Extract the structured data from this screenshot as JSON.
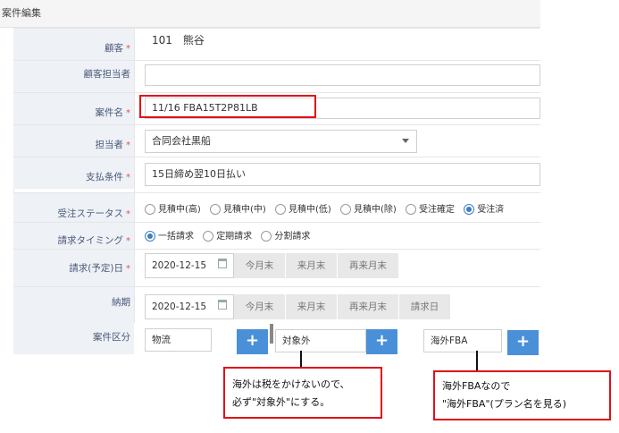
{
  "header": {
    "title": "案件編集"
  },
  "form": {
    "customer": {
      "label": "顧客",
      "value": "101　熊谷"
    },
    "customer_contact": {
      "label": "顧客担当者",
      "value": ""
    },
    "project_name": {
      "label": "案件名",
      "value": "11/16  FBA15T2P81LB"
    },
    "assignee": {
      "label": "担当者",
      "value": "合同会社黒船"
    },
    "payment_terms": {
      "label": "支払条件",
      "value": "15日締め翌10日払い"
    },
    "order_status": {
      "label": "受注ステータス",
      "options": [
        "見積中(高)",
        "見積中(中)",
        "見積中(低)",
        "見積中(除)",
        "受注確定",
        "受注済"
      ],
      "selected": "受注済"
    },
    "billing_timing": {
      "label": "請求タイミング",
      "options": [
        "一括請求",
        "定期請求",
        "分割請求"
      ],
      "selected": "一括請求"
    },
    "billing_date": {
      "label": "請求(予定)日",
      "value": "2020-12-15",
      "buttons": [
        "今月末",
        "来月末",
        "再来月末"
      ]
    },
    "due_date": {
      "label": "納期",
      "value": "2020-12-15",
      "buttons": [
        "今月末",
        "来月末",
        "再来月末",
        "請求日"
      ]
    },
    "category": {
      "label": "案件区分",
      "values": [
        "物流",
        "対象外",
        "海外FBA"
      ],
      "add_label": "+"
    },
    "required_mark": "*"
  },
  "annotations": {
    "note1_line1": "海外は税をかけないので、",
    "note1_line2": "必ず\"対象外\"にする。",
    "note2_line1": "海外FBAなので",
    "note2_line2": "\"海外FBA\"(プラン名を見る)"
  },
  "colors": {
    "accent": "#4a90d9",
    "highlight": "#e0101a",
    "label_bg": "#eef1f6"
  }
}
